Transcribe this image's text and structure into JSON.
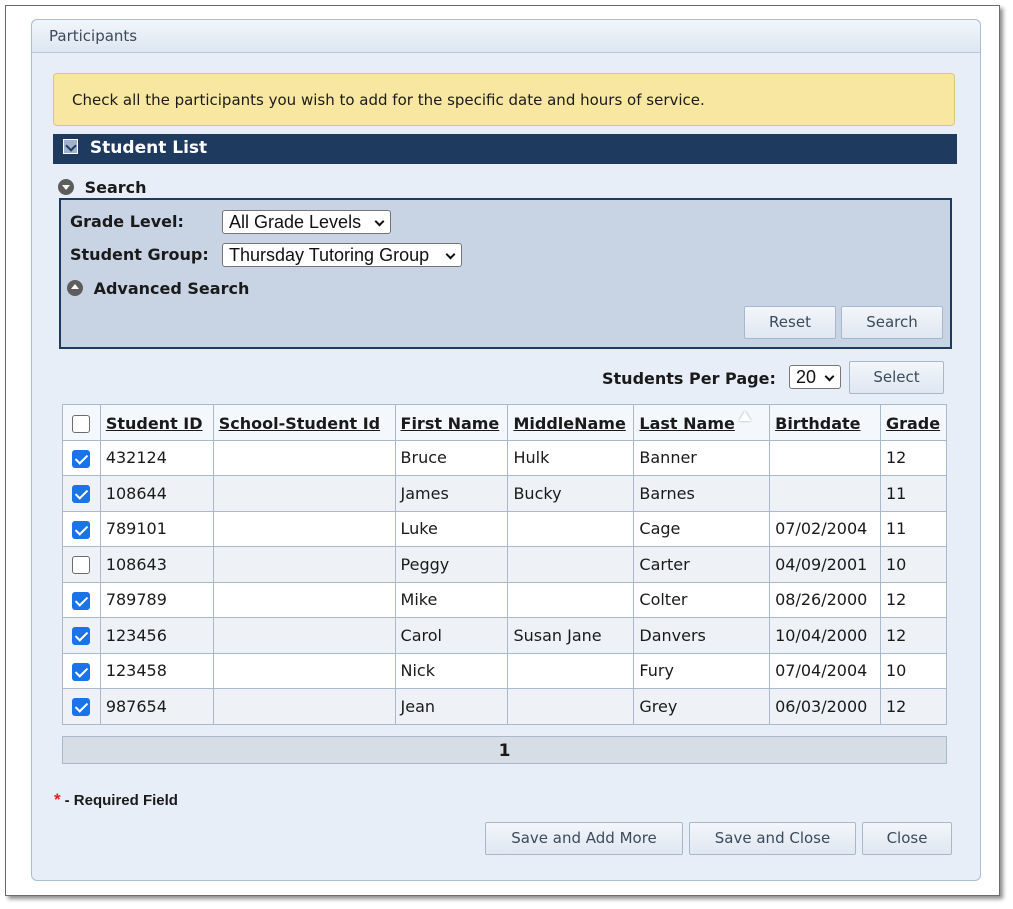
{
  "panel": {
    "title": "Participants"
  },
  "notice": "Check all the participants you wish to add for the specific date and hours of service.",
  "student_list": {
    "title": "Student List"
  },
  "search": {
    "label": "Search",
    "grade_level_label": "Grade Level:",
    "grade_level_value": "All Grade Levels",
    "student_group_label": "Student Group:",
    "student_group_value": "Thursday Tutoring Group",
    "advanced_label": "Advanced Search",
    "reset_label": "Reset",
    "search_label": "Search"
  },
  "pagination": {
    "per_page_label": "Students Per Page:",
    "per_page_value": "20",
    "select_label": "Select",
    "current_page": "1"
  },
  "table": {
    "columns": [
      "Student ID",
      "School-Student Id",
      "First Name",
      "MiddleName",
      "Last Name",
      "Birthdate",
      "Grade"
    ],
    "sorted_column": "Last Name",
    "rows": [
      {
        "checked": true,
        "student_id": "432124",
        "school_id": "",
        "first": "Bruce",
        "middle": "Hulk",
        "last": "Banner",
        "birthdate": "",
        "grade": "12"
      },
      {
        "checked": true,
        "student_id": "108644",
        "school_id": "",
        "first": "James",
        "middle": "Bucky",
        "last": "Barnes",
        "birthdate": "",
        "grade": "11"
      },
      {
        "checked": true,
        "student_id": "789101",
        "school_id": "",
        "first": "Luke",
        "middle": "",
        "last": "Cage",
        "birthdate": "07/02/2004",
        "grade": "11"
      },
      {
        "checked": false,
        "student_id": "108643",
        "school_id": "",
        "first": "Peggy",
        "middle": "",
        "last": "Carter",
        "birthdate": "04/09/2001",
        "grade": "10"
      },
      {
        "checked": true,
        "student_id": "789789",
        "school_id": "",
        "first": "Mike",
        "middle": "",
        "last": "Colter",
        "birthdate": "08/26/2000",
        "grade": "12"
      },
      {
        "checked": true,
        "student_id": "123456",
        "school_id": "",
        "first": "Carol",
        "middle": "Susan Jane",
        "last": "Danvers",
        "birthdate": "10/04/2000",
        "grade": "12"
      },
      {
        "checked": true,
        "student_id": "123458",
        "school_id": "",
        "first": "Nick",
        "middle": "",
        "last": "Fury",
        "birthdate": "07/04/2004",
        "grade": "10"
      },
      {
        "checked": true,
        "student_id": "987654",
        "school_id": "",
        "first": "Jean",
        "middle": "",
        "last": "Grey",
        "birthdate": "06/03/2000",
        "grade": "12"
      }
    ]
  },
  "footer": {
    "required_star": "*",
    "required_text": "- Required Field",
    "save_add_more": "Save and Add More",
    "save_close": "Save and Close",
    "close": "Close"
  },
  "colors": {
    "header_bar": "#1f3a5f",
    "notice_bg": "#f8e7a0",
    "checkbox_checked": "#1a73e8",
    "required_star": "#e02020"
  }
}
